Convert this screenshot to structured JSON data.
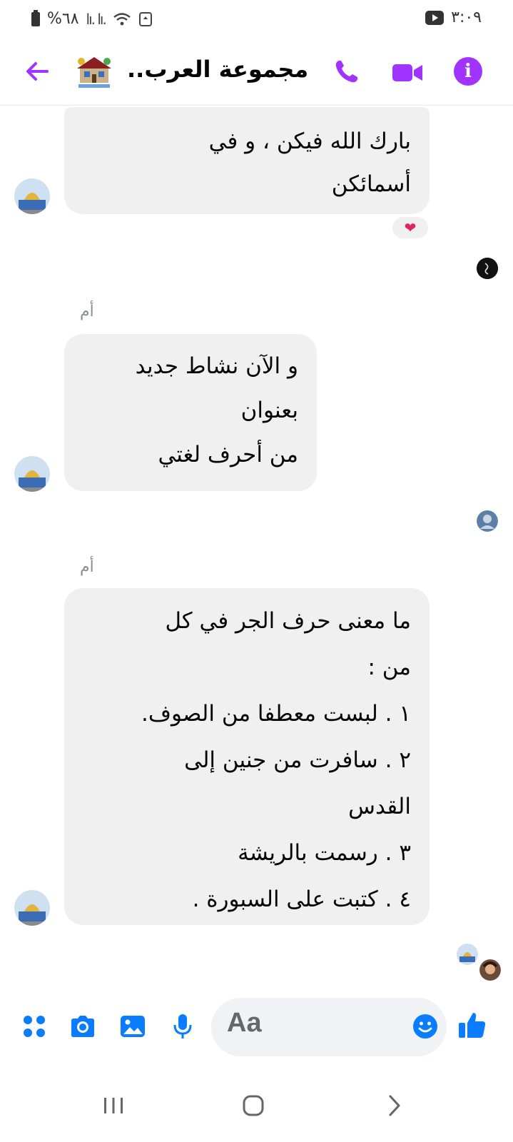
{
  "status_bar": {
    "battery": "%٦٨",
    "signal": "lı. lı.",
    "time": "٣:٠٩"
  },
  "header": {
    "title": "مجموعة العرب..",
    "accent_color": "#a033ff",
    "icons": [
      "back-arrow-icon",
      "phone-icon",
      "video-camera-icon",
      "info-icon"
    ]
  },
  "messages": [
    {
      "text": "بارك الله فيكن ، و في\nأسمائكن",
      "reaction": "❤"
    },
    {
      "sender": "أم",
      "text": "و الآن نشاط جديد\nبعنوان\nمن أحرف لغتي"
    },
    {
      "sender": "أم",
      "text": "ما معنى حرف الجر في كل\nمن :\n١ . لبست معطفا من الصوف.\n٢ . سافرت من جنين إلى\nالقدس\n٣ . رسمت بالريشة\n٤ . كتبت على السبورة ."
    }
  ],
  "composer": {
    "placeholder": "Aa",
    "accent_color": "#0a7cff",
    "icons": [
      "apps-icon",
      "camera-icon",
      "gallery-icon",
      "microphone-icon",
      "emoji-icon",
      "thumbs-up-icon"
    ]
  },
  "nav_bar": {
    "icons": [
      "recent-apps-icon",
      "home-icon",
      "back-icon"
    ]
  }
}
